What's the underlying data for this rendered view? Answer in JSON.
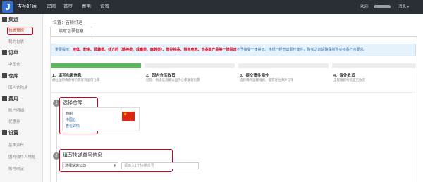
{
  "topbar": {
    "logo": "J",
    "brand": "吉祯好运",
    "nav": [
      "官网",
      "首页",
      "费用",
      "设置"
    ],
    "welcome": "欢迎:",
    "messages": "消息 ▾"
  },
  "sidebar": {
    "sections": [
      {
        "title": "集运",
        "icon": "home-icon",
        "items": [
          "包裹预报",
          "我的包裹"
        ]
      },
      {
        "title": "订单",
        "icon": "order-icon",
        "items": [
          "中国仓"
        ]
      },
      {
        "title": "仓库",
        "icon": "warehouse-icon",
        "items": [
          "国内仓地址"
        ]
      },
      {
        "title": "费用",
        "icon": "wallet-icon",
        "items": [
          "账户明细",
          "优惠券"
        ]
      },
      {
        "title": "设置",
        "icon": "gear-icon",
        "items": [
          "基本资料",
          "国外收件人地址",
          "账号绑定"
        ]
      }
    ],
    "active_item": "包裹预报"
  },
  "location": "位置：吉祯好运",
  "tab_label": "填写包裹信息",
  "tip": {
    "prefix": "重要提示：",
    "bold": "液体、粉末、武器类、处方药（精神类、成瘾类、麻醉类）、管控物品、带电电池、全品类产品等一律禁运",
    "rest": "不予接受一律禁运。违规一经查出即作废件，购买之前请确保所购买物品符合要求。"
  },
  "steps": [
    {
      "title": "1、填写包裹信息",
      "desc": "通过国内快递将包裹寄到国内仓库",
      "active": true
    },
    {
      "title": "2、国内仓库收货",
      "desc": "验货、物流信息确认国内仓库收到包裹",
      "active": false
    },
    {
      "title": "3、提交寄往海外",
      "desc": "选择海外运输线路，提交寄往海外订单",
      "active": false
    },
    {
      "title": "4、海外收货",
      "desc": "全程跟踪物流直至收货",
      "active": false
    }
  ],
  "section1": {
    "number": "1",
    "title": "选择仓库",
    "warehouse": {
      "name": "西丽",
      "sub": "中国仓",
      "link": "查看详情"
    }
  },
  "section2": {
    "number": "2",
    "title": "填写快递单号信息",
    "select_value": "选择快递公司",
    "input_placeholder": "请输入1个快递单号"
  },
  "colors": {
    "accent": "#5cb85c",
    "highlight": "#d0021b",
    "topbar": "#2a2f36",
    "link": "#2a6fb0"
  }
}
